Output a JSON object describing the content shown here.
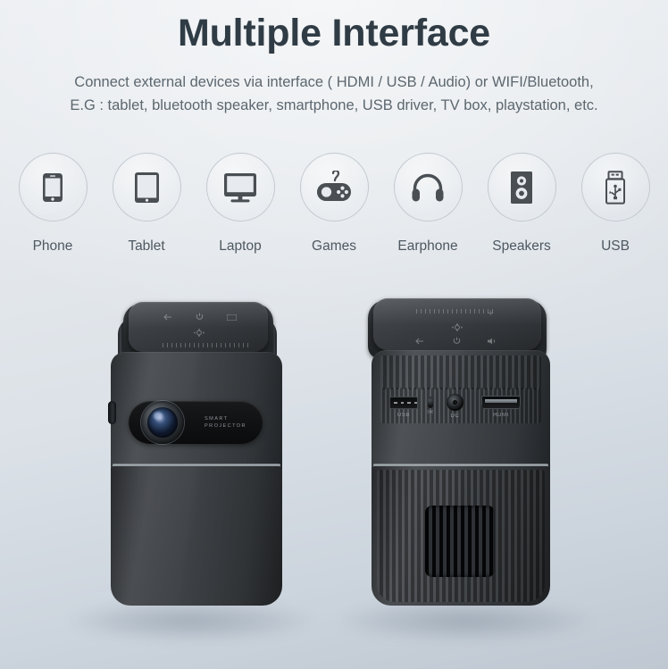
{
  "header": {
    "title": "Multiple Interface",
    "subtitle_line1": "Connect external devices via interface ( HDMI / USB / Audio) or WIFI/Bluetooth,",
    "subtitle_line2": "E.G : tablet,  bluetooth speaker,  smartphone,  USB driver,  TV box,  playstation,  etc."
  },
  "devices": [
    {
      "label": "Phone",
      "icon": "smartphone-icon"
    },
    {
      "label": "Tablet",
      "icon": "tablet-icon"
    },
    {
      "label": "Laptop",
      "icon": "monitor-icon"
    },
    {
      "label": "Games",
      "icon": "gamepad-icon"
    },
    {
      "label": "Earphone",
      "icon": "headphones-icon"
    },
    {
      "label": "Speakers",
      "icon": "speaker-icon"
    },
    {
      "label": "USB",
      "icon": "usb-drive-icon"
    }
  ],
  "products": {
    "front": {
      "name": "Smart projector front view",
      "brand_line1": "SMART",
      "brand_line2": "PROJECTOR"
    },
    "rear": {
      "name": "Smart projector rear view",
      "ports": [
        {
          "label": "USB",
          "type": "usb-port"
        },
        {
          "label": "IR",
          "type": "ir-sensor"
        },
        {
          "label": "DC",
          "type": "dc-power-jack"
        },
        {
          "label": "HDMI",
          "type": "hdmi-port"
        }
      ]
    }
  },
  "colors": {
    "title": "#303c45",
    "subtitle": "#5c676f",
    "icon_label": "#4e5861",
    "circle_border": "#c2c9d0",
    "icon_glyph": "#4a4f54",
    "background_top": "#eaedf1",
    "background_bottom": "#bfc8d2",
    "device_body": "#3a3e42"
  }
}
